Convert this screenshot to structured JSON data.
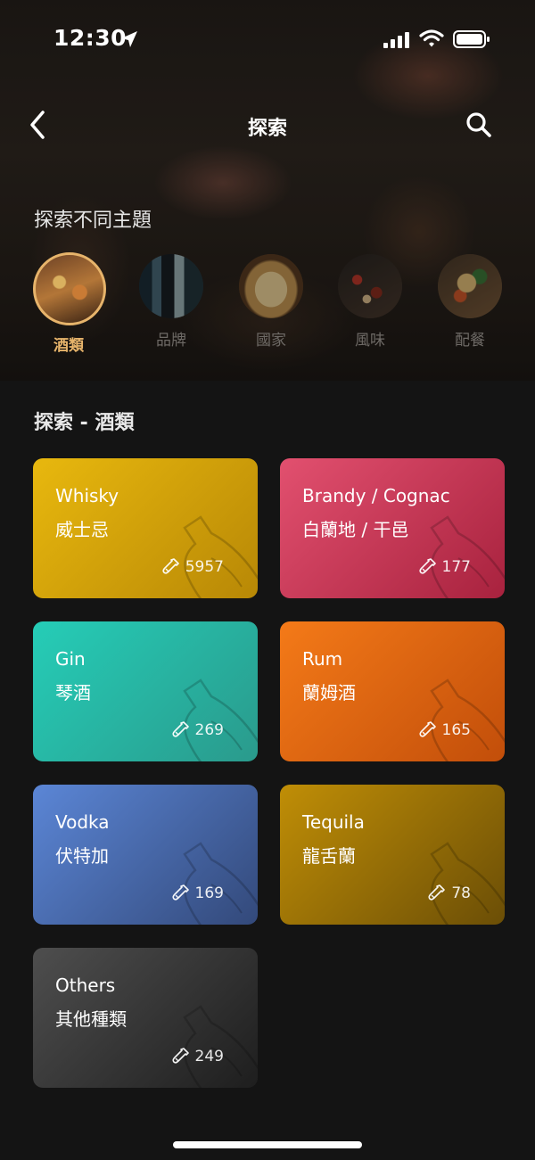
{
  "status_bar": {
    "time": "12:30"
  },
  "nav": {
    "title": "探索"
  },
  "themes_section": {
    "heading": "探索不同主題",
    "items": [
      {
        "label": "酒類",
        "active": true
      },
      {
        "label": "品牌",
        "active": false
      },
      {
        "label": "國家",
        "active": false
      },
      {
        "label": "風味",
        "active": false
      },
      {
        "label": "配餐",
        "active": false
      }
    ]
  },
  "list": {
    "title": "探索 - 酒類",
    "cards": [
      {
        "name": "Whisky",
        "subname": "威士忌",
        "count": "5957",
        "color_start": "#e8b80e",
        "color_end": "#b88806"
      },
      {
        "name": "Brandy / Cognac",
        "subname": "白蘭地 / 干邑",
        "count": "177",
        "color_start": "#e2506f",
        "color_end": "#a8223e"
      },
      {
        "name": "Gin",
        "subname": "琴酒",
        "count": "269",
        "color_start": "#25cdb7",
        "color_end": "#2a9a8c"
      },
      {
        "name": "Rum",
        "subname": "蘭姆酒",
        "count": "165",
        "color_start": "#f47a18",
        "color_end": "#c24e0a"
      },
      {
        "name": "Vodka",
        "subname": "伏特加",
        "count": "169",
        "color_start": "#5b86d6",
        "color_end": "#33497a"
      },
      {
        "name": "Tequila",
        "subname": "龍舌蘭",
        "count": "78",
        "color_start": "#c08e06",
        "color_end": "#6b4e06"
      },
      {
        "name": "Others",
        "subname": "其他種類",
        "count": "249",
        "color_start": "#4e4e4e",
        "color_end": "#1e1e1e"
      }
    ]
  },
  "colors": {
    "accent": "#e7b46b",
    "background": "#141414"
  }
}
